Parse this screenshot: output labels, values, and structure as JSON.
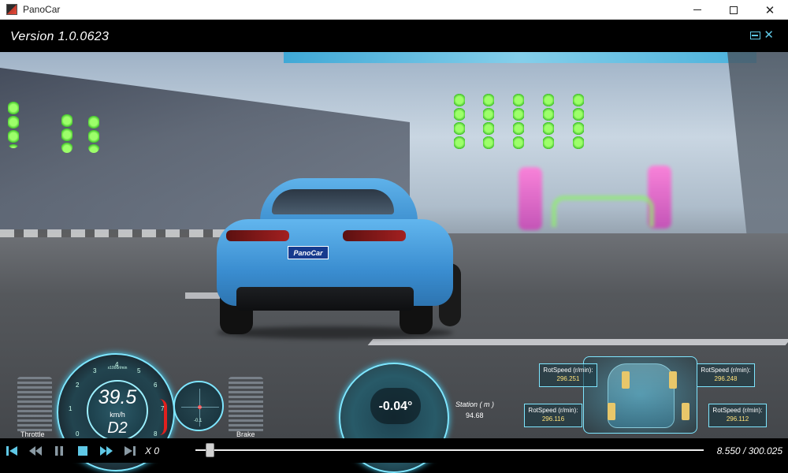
{
  "window": {
    "title": "PanoCar"
  },
  "header": {
    "version": "Version 1.0.0623"
  },
  "scene": {
    "plate_text": "PanoCar"
  },
  "hud": {
    "throttle_label": "Throttle",
    "brake_label": "Brake",
    "speed": {
      "value": "39.5",
      "unit": "km/h",
      "gear": "D2",
      "rpm_label": "x1000r/min"
    },
    "speedo_ticks": [
      "0",
      "1",
      "2",
      "3",
      "4",
      "5",
      "6",
      "7",
      "8"
    ],
    "compass_value": "-0.1",
    "steering": {
      "angle": "-0.04°"
    },
    "station": {
      "label": "Station ( m )",
      "value": "94.68"
    },
    "wheels": [
      {
        "label": "RotSpeed (r/min):",
        "value": "296.251"
      },
      {
        "label": "RotSpeed (r/min):",
        "value": "296.248"
      },
      {
        "label": "RotSpeed (r/min):",
        "value": "296.116"
      },
      {
        "label": "RotSpeed (r/min):",
        "value": "296.112"
      }
    ]
  },
  "playback": {
    "speed_multiplier": "X 0",
    "time": "8.550 / 300.025",
    "progress": 0.028
  },
  "colors": {
    "accent": "#7ee6ff",
    "tire": "#e8c76a",
    "value_yellow": "#ffe27a"
  },
  "icons": [
    "skip-start-icon",
    "rewind-icon",
    "pause-icon",
    "stop-icon",
    "fast-forward-icon",
    "skip-end-icon",
    "restore-icon",
    "close-icon"
  ]
}
